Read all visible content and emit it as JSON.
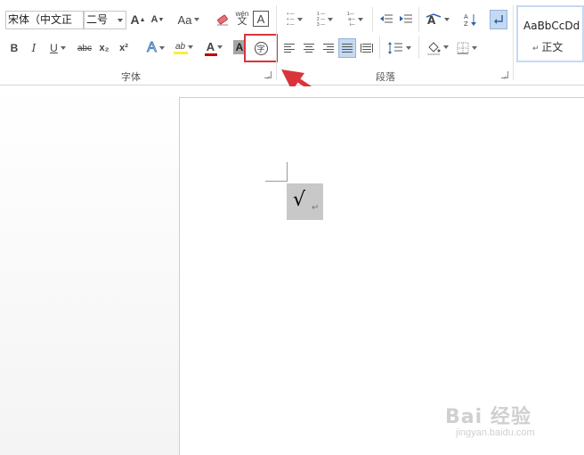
{
  "ribbon": {
    "font_group": {
      "label": "字体",
      "font_name": "宋体（中文正",
      "font_size": "二号",
      "grow_font_label": "A",
      "shrink_font_label": "A",
      "change_case_label": "Aa",
      "phonetic_top": "wén",
      "phonetic_bottom": "文",
      "char_border_label": "A",
      "bold_label": "B",
      "italic_label": "I",
      "underline_label": "U",
      "strikethrough_label": "abc",
      "subscript_label": "x₂",
      "superscript_label": "x²",
      "text_effects_label": "A",
      "highlight_label": "ab",
      "font_color_label": "A",
      "char_shading_label": "A",
      "enclose_char_label": "字"
    },
    "paragraph_group": {
      "label": "段落"
    },
    "styles_group": {
      "sample_text": "AaBbCcDd",
      "style_name": "正文"
    }
  },
  "document": {
    "selected_character": "√",
    "paragraph_mark": "↵"
  },
  "watermark": {
    "logo": "Bai 经验",
    "url": "jingyan.baidu.com"
  },
  "colors": {
    "annotation_red": "#d9343a",
    "highlight_yellow": "#ffeb3b",
    "font_red": "#c00000",
    "selected_bg": "#c5d9f1"
  }
}
